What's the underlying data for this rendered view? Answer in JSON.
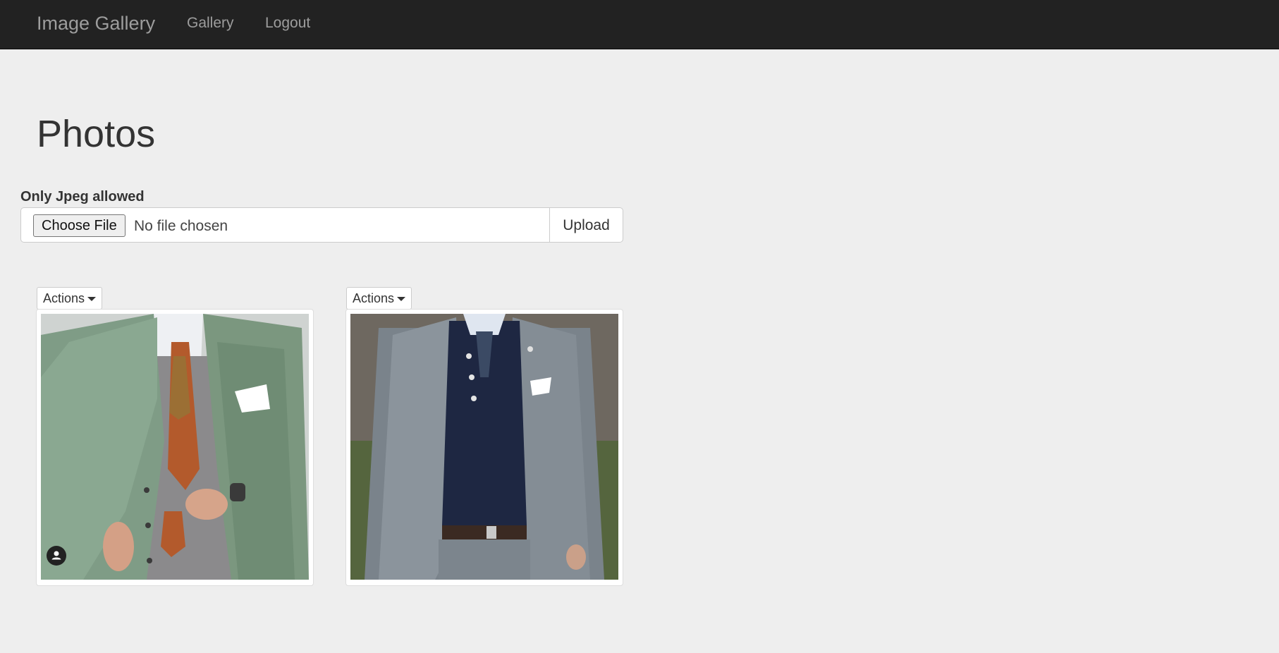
{
  "navbar": {
    "brand": "Image Gallery",
    "links": [
      {
        "label": "Gallery"
      },
      {
        "label": "Logout"
      }
    ]
  },
  "page": {
    "title": "Photos"
  },
  "upload": {
    "label": "Only Jpeg allowed",
    "choose_button": "Choose File",
    "file_status": "No file chosen",
    "upload_button": "Upload"
  },
  "photos": [
    {
      "actions_label": "Actions",
      "description": "man in green blazer with orange paisley tie",
      "has_avatar_badge": true
    },
    {
      "actions_label": "Actions",
      "description": "man in grey suit with navy sweater and floral tie",
      "has_avatar_badge": false
    }
  ],
  "colors": {
    "navbar_bg": "#222222",
    "nav_text": "#9d9d9d",
    "page_bg": "#eeeeee",
    "text": "#333333"
  }
}
